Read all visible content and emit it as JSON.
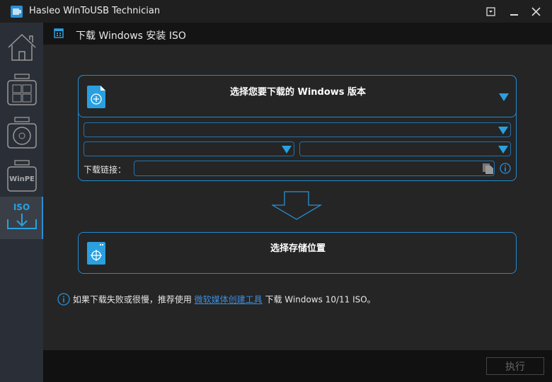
{
  "window": {
    "title": "Hasleo WinToUSB Technician"
  },
  "sidebar": {
    "winpe_label": "WinPE",
    "iso_label": "ISO"
  },
  "header": {
    "title": "下载 Windows 安装 ISO"
  },
  "section1": {
    "title": "选择您要下载的 Windows 版本",
    "link_label": "下载链接：",
    "link_value": ""
  },
  "section2": {
    "title": "选择存储位置"
  },
  "info": {
    "prefix": "如果下载失败或很慢，推荐使用 ",
    "link": "微软媒体创建工具",
    "suffix": " 下载 Windows 10/11 ISO。"
  },
  "footer": {
    "execute_label": "执行"
  },
  "colors": {
    "accent": "#1f8ad2",
    "icon": "#2aa0e0"
  }
}
